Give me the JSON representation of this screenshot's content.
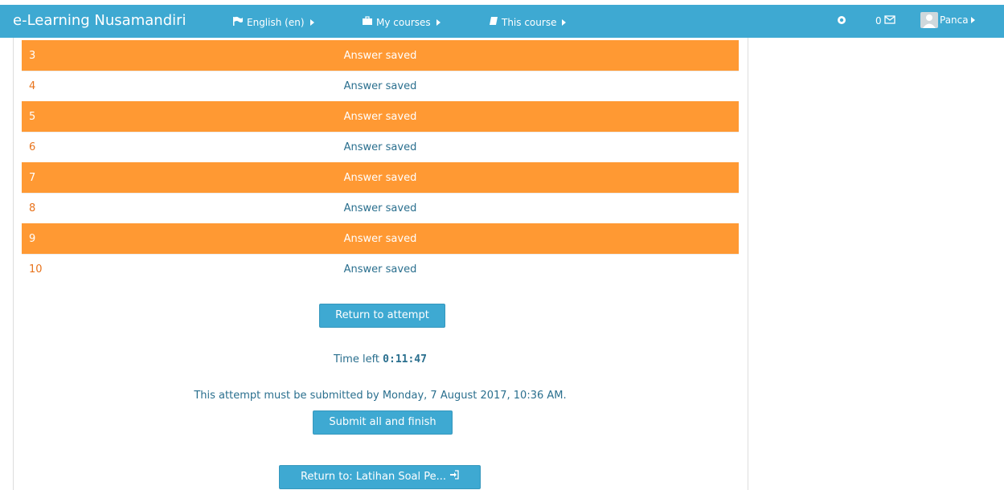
{
  "header": {
    "brand": "e-Learning Nusamandiri",
    "language_label": "English (en)",
    "my_courses_label": "My courses",
    "this_course_label": "This course",
    "message_count": "0",
    "user_name": "Panca"
  },
  "summary": {
    "rows": [
      {
        "number": "3",
        "status": "Answer saved"
      },
      {
        "number": "4",
        "status": "Answer saved"
      },
      {
        "number": "5",
        "status": "Answer saved"
      },
      {
        "number": "6",
        "status": "Answer saved"
      },
      {
        "number": "7",
        "status": "Answer saved"
      },
      {
        "number": "8",
        "status": "Answer saved"
      },
      {
        "number": "9",
        "status": "Answer saved"
      },
      {
        "number": "10",
        "status": "Answer saved"
      }
    ]
  },
  "actions": {
    "return_to_attempt_label": "Return to attempt",
    "time_left_label": "Time left",
    "time_left_value": "0:11:47",
    "deadline_text": "This attempt must be submitted by Monday, 7 August 2017, 10:36 AM.",
    "submit_label": "Submit all and finish",
    "return_to_label": "Return to: Latihan Soal Pe..."
  },
  "colors": {
    "navbar": "#3ea9d2",
    "row_highlight": "#ff9933",
    "button": "#3ea9d2",
    "status_text": "#2a6f8e"
  },
  "icons": {
    "language": "flag-icon",
    "my_courses": "briefcase-icon",
    "this_course": "book-icon",
    "notifications": "notification-icon",
    "messages": "envelope-icon",
    "user": "user-avatar-icon",
    "return_to": "sign-in-icon"
  }
}
